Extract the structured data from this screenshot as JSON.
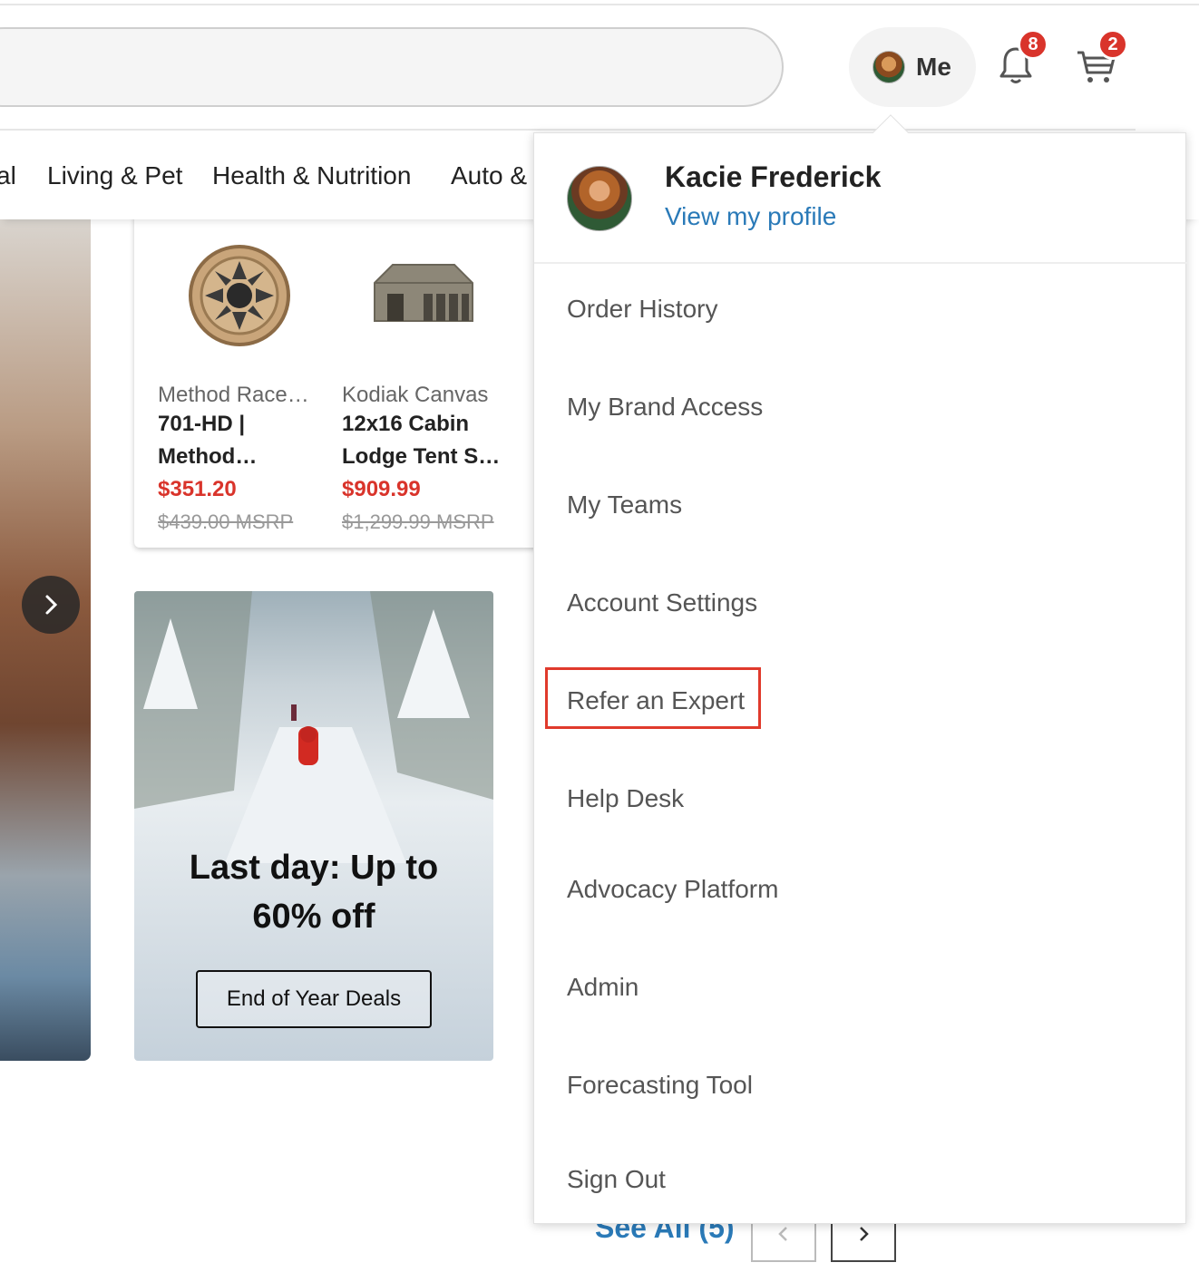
{
  "header": {
    "me_label": "Me",
    "notifications_count": "8",
    "cart_count": "2",
    "search_placeholder": ""
  },
  "nav": {
    "items": [
      "al",
      "Living & Pet",
      "Health & Nutrition",
      "Auto &"
    ]
  },
  "products": [
    {
      "brand": "Method Race…",
      "name_line1": "701-HD |",
      "name_line2": "Method…",
      "price": "$351.20",
      "msrp": "$439.00 MSRP"
    },
    {
      "brand": "Kodiak Canvas",
      "name_line1": "12x16 Cabin",
      "name_line2": "Lodge Tent S…",
      "price": "$909.99",
      "msrp": "$1,299.99 MSRP"
    }
  ],
  "promo": {
    "headline_line1": "Last day: Up to",
    "headline_line2": "60% off",
    "button_label": "End of Year Deals"
  },
  "footer": {
    "see_all": "See All (5)"
  },
  "dropdown": {
    "user_name": "Kacie Frederick",
    "profile_link": "View my profile",
    "items": [
      "Order History",
      "My Brand Access",
      "My Teams",
      "Account Settings",
      "Refer an Expert",
      "Help Desk",
      "Advocacy Platform",
      "Admin",
      "Forecasting Tool",
      "Sign Out"
    ],
    "highlighted_item": "Refer an Expert"
  },
  "colors": {
    "accent_red": "#d9342b",
    "link_blue": "#2a7ab8",
    "highlight_border": "#e03a2c"
  }
}
